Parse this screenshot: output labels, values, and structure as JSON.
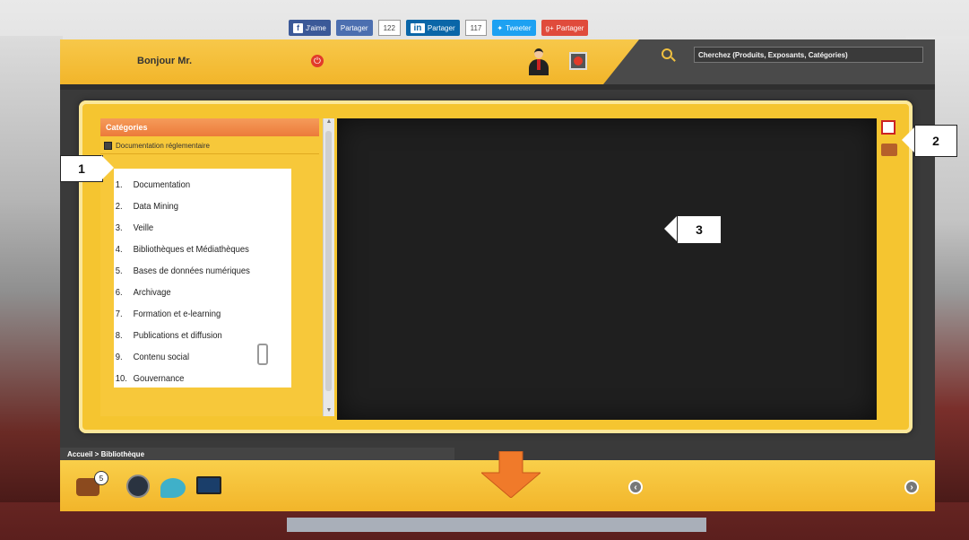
{
  "share": {
    "facebook_like": "J'aime",
    "facebook_share": "Partager",
    "facebook_count": "122",
    "linkedin_share": "Partager",
    "linkedin_count": "117",
    "twitter": "Tweeter",
    "googleplus": "Partager"
  },
  "header": {
    "greeting": "Bonjour Mr.",
    "search_placeholder": "Cherchez (Produits, Exposants, Catégories)"
  },
  "sidebar": {
    "title": "Catégories",
    "category": "Documentation réglementaire",
    "items": [
      {
        "num": "1.",
        "label": "Documentation"
      },
      {
        "num": "2.",
        "label": "Data Mining"
      },
      {
        "num": "3.",
        "label": "Veille"
      },
      {
        "num": "4.",
        "label": "Bibliothèques et Médiathèques"
      },
      {
        "num": "5.",
        "label": "Bases de données numériques"
      },
      {
        "num": "6.",
        "label": "Archivage"
      },
      {
        "num": "7.",
        "label": "Formation et e-learning"
      },
      {
        "num": "8.",
        "label": "Publications et diffusion"
      },
      {
        "num": "9.",
        "label": "Contenu social"
      },
      {
        "num": "10.",
        "label": "Gouvernance"
      }
    ]
  },
  "callouts": {
    "one": "1",
    "two": "2",
    "three": "3"
  },
  "footer": {
    "breadcrumb": "Accueil > Bibliothèque",
    "chest_badge": "5"
  },
  "colors": {
    "accent_yellow": "#f2b52a",
    "category_header": "#ec7b3a",
    "viewer": "#1f1f1f"
  }
}
